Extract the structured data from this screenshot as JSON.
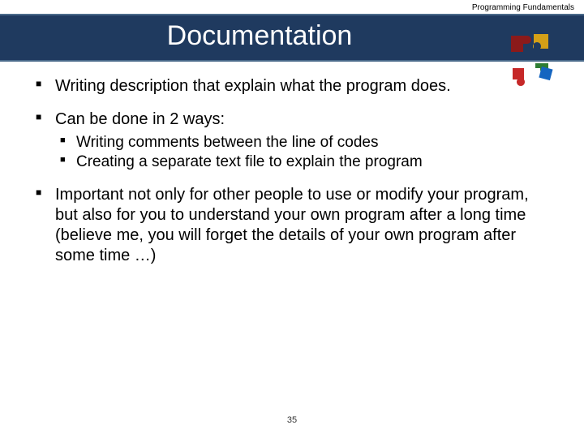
{
  "header": {
    "label": "Programming Fundamentals"
  },
  "title": "Documentation",
  "bullets": [
    {
      "text": "Writing description that explain what the program does."
    },
    {
      "text": "Can be done in 2 ways:",
      "sub": [
        "Writing comments between the line of codes",
        "Creating a separate text file to explain the program"
      ]
    },
    {
      "text": "Important not only for other people to use or modify your program, but also for you to understand your own program after a long time (believe me, you will forget the details of your own program after some time …)"
    }
  ],
  "page_number": "35"
}
